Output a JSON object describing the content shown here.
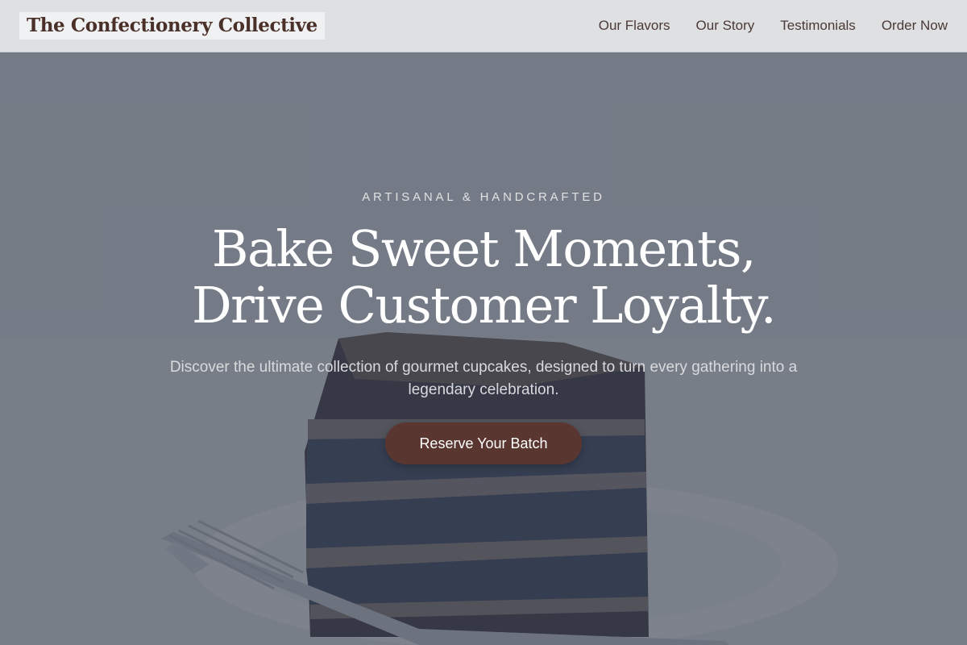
{
  "header": {
    "brand": "The Confectionery Collective",
    "nav": [
      {
        "label": "Our Flavors"
      },
      {
        "label": "Our Story"
      },
      {
        "label": "Testimonials"
      },
      {
        "label": "Order Now"
      }
    ]
  },
  "hero": {
    "eyebrow": "ARTISANAL & HANDCRAFTED",
    "headline_line1": "Bake Sweet Moments,",
    "headline_line2": "Drive Customer Loyalty.",
    "subtext": "Discover the ultimate collection of gourmet cupcakes, designed to turn every gathering into a legendary celebration.",
    "cta_label": "Reserve Your Batch"
  },
  "colors": {
    "brand_text": "#4a3028",
    "cta_background": "#5a3630",
    "overlay": "#343c4a",
    "header_background": "#e2e3e5"
  }
}
